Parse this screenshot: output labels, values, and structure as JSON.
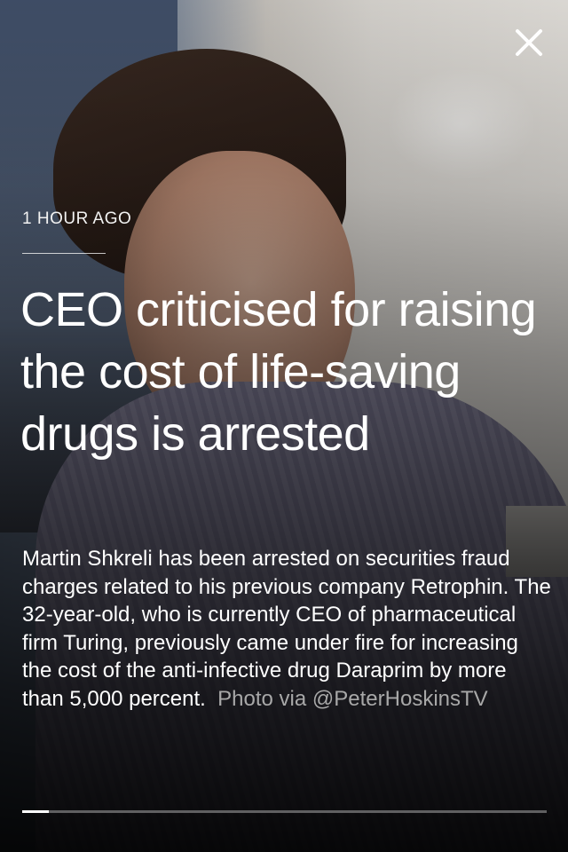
{
  "story": {
    "timestamp": "1 HOUR AGO",
    "headline": "CEO criticised for raising the cost of life-saving drugs is arrested",
    "body": "Martin Shkreli has been arrested on securities fraud charges related to his previous company Retrophin. The 32-year-old, who is currently CEO of pharmaceutical firm Turing, previously came under fire for increasing the cost of the anti-infective drug Daraprim by more than 5,000 percent.",
    "photo_credit": "Photo via @PeterHoskinsTV"
  },
  "controls": {
    "close_icon": "close-x-icon"
  },
  "progress": {
    "fraction": 0.05
  },
  "colors": {
    "text": "#ffffff",
    "credit": "#a8a8a8",
    "progress_track": "rgba(255,255,255,0.35)",
    "progress_fill": "#ffffff"
  }
}
